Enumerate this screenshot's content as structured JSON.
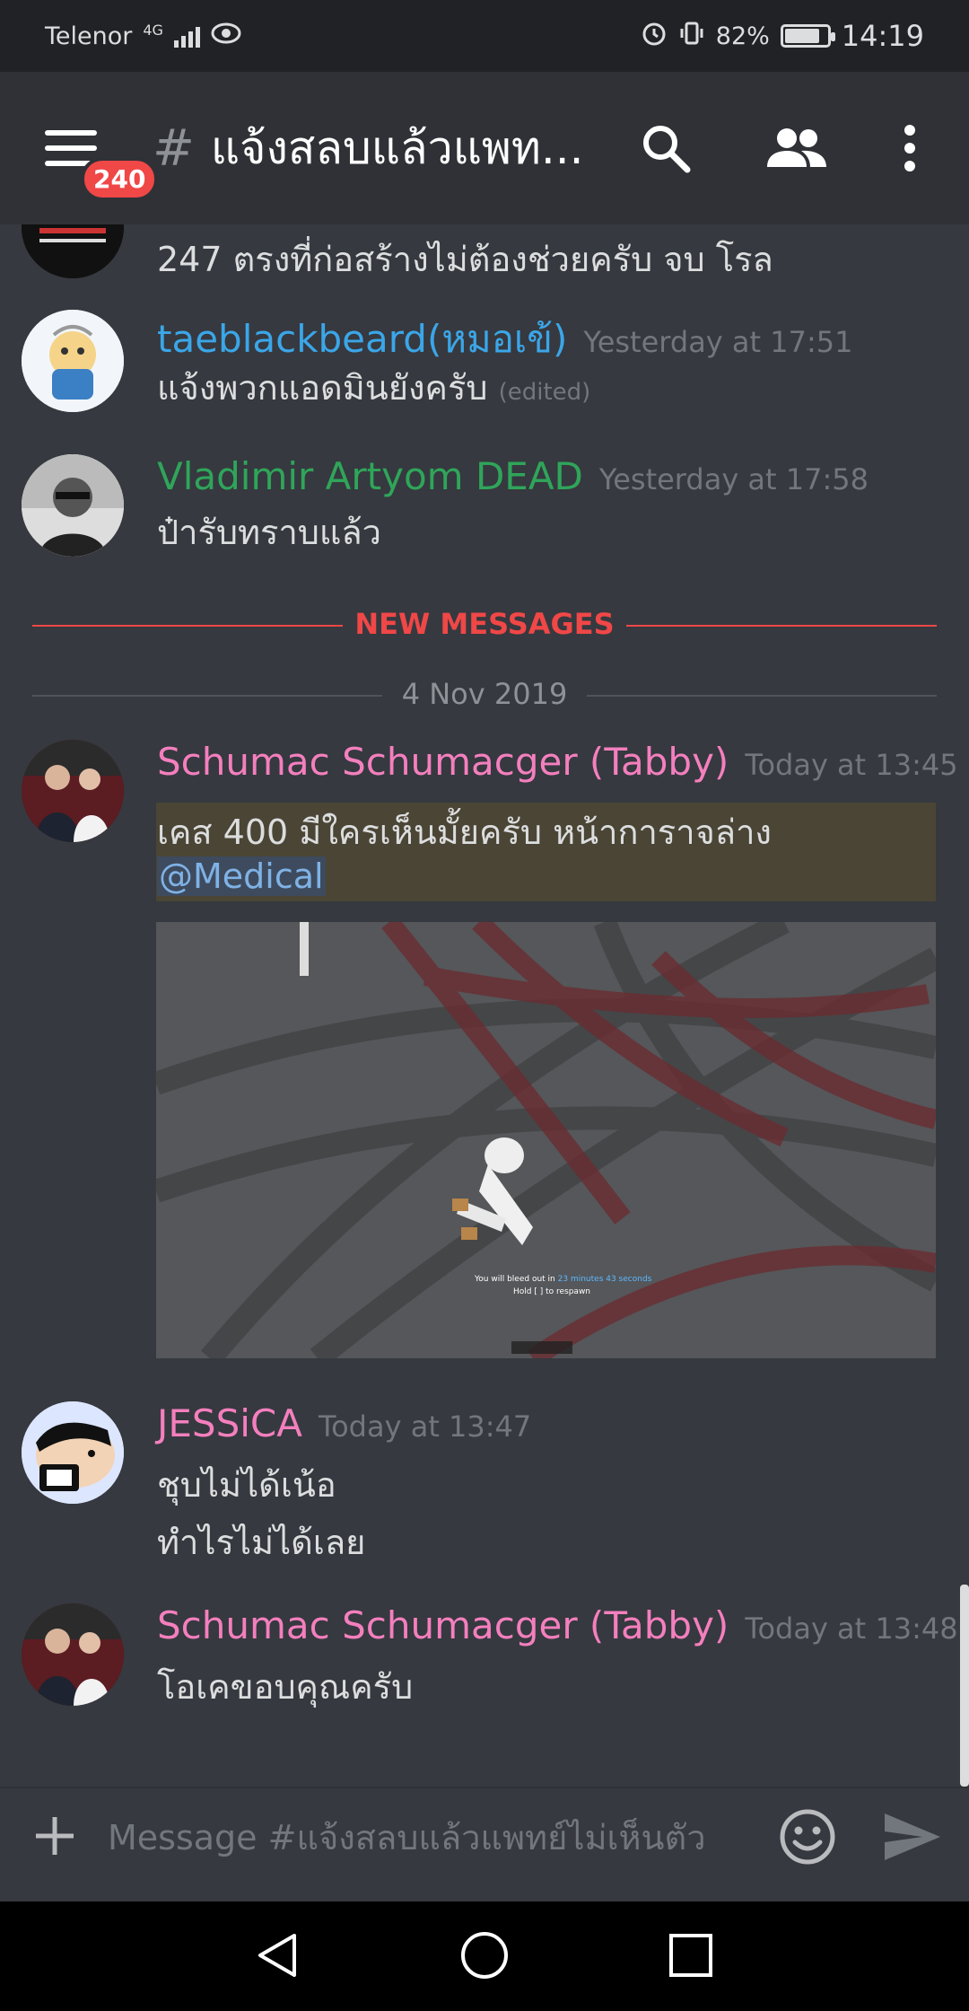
{
  "status_bar": {
    "carrier": "Telenor",
    "network": "4G",
    "battery": "82%",
    "battery_level": 0.82,
    "time": "14:19"
  },
  "header": {
    "menu_badge": "240",
    "hash": "#",
    "channel_name": "แจ้งสลบแล้วแพท..."
  },
  "messages": [
    {
      "text": "247 ตรงที่ก่อสร้างไม่ต้องช่วยครับ จบ โรล"
    },
    {
      "author": "taeblackbeard(หมอเข้)",
      "author_color": "#3ba6e8",
      "timestamp": "Yesterday at 17:51",
      "text": "แจ้งพวกแอดมินยังครับ",
      "edited": "(edited)"
    },
    {
      "author": "Vladimir Artyom DEAD",
      "author_color": "#2fa55a",
      "timestamp": "Yesterday at 17:58",
      "text": "ป๋ารับทราบแล้ว"
    }
  ],
  "new_messages_label": "NEW MESSAGES",
  "date_divider": "4 Nov 2019",
  "today_messages": [
    {
      "author": "Schumac Schumacger (Tabby)",
      "author_color": "#f47fbe",
      "timestamp": "Today at 13:45",
      "line1": "เคส 400 มีใครเห็นมั้ยครับ หน้าการาจล่าง",
      "mention": "@Medical",
      "image_caption_1": "You will bleed out in",
      "image_caption_time": "23 minutes 43 seconds",
      "image_caption_2": "Hold [ ] to respawn"
    },
    {
      "author": "JESSiCA",
      "author_color": "#f47fbe",
      "timestamp": "Today at 13:47",
      "line1": "ชุบไม่ได้เน้อ",
      "line2": "ทำไรไม่ได้เลย"
    },
    {
      "author": "Schumac Schumacger (Tabby)",
      "author_color": "#f47fbe",
      "timestamp": "Today at 13:48",
      "line1": "โอเคขอบคุณครับ"
    }
  ],
  "composer": {
    "placeholder": "Message #แจ้งสลบแล้วแพทย์ไม่เห็นตัว"
  },
  "icons": {
    "menu": "hamburger-icon",
    "search": "search-icon",
    "members": "members-icon",
    "more": "more-vert-icon",
    "add": "plus-icon",
    "emoji": "emoji-icon",
    "send": "send-icon",
    "back": "back-icon",
    "home": "home-icon",
    "recents": "recents-icon"
  }
}
